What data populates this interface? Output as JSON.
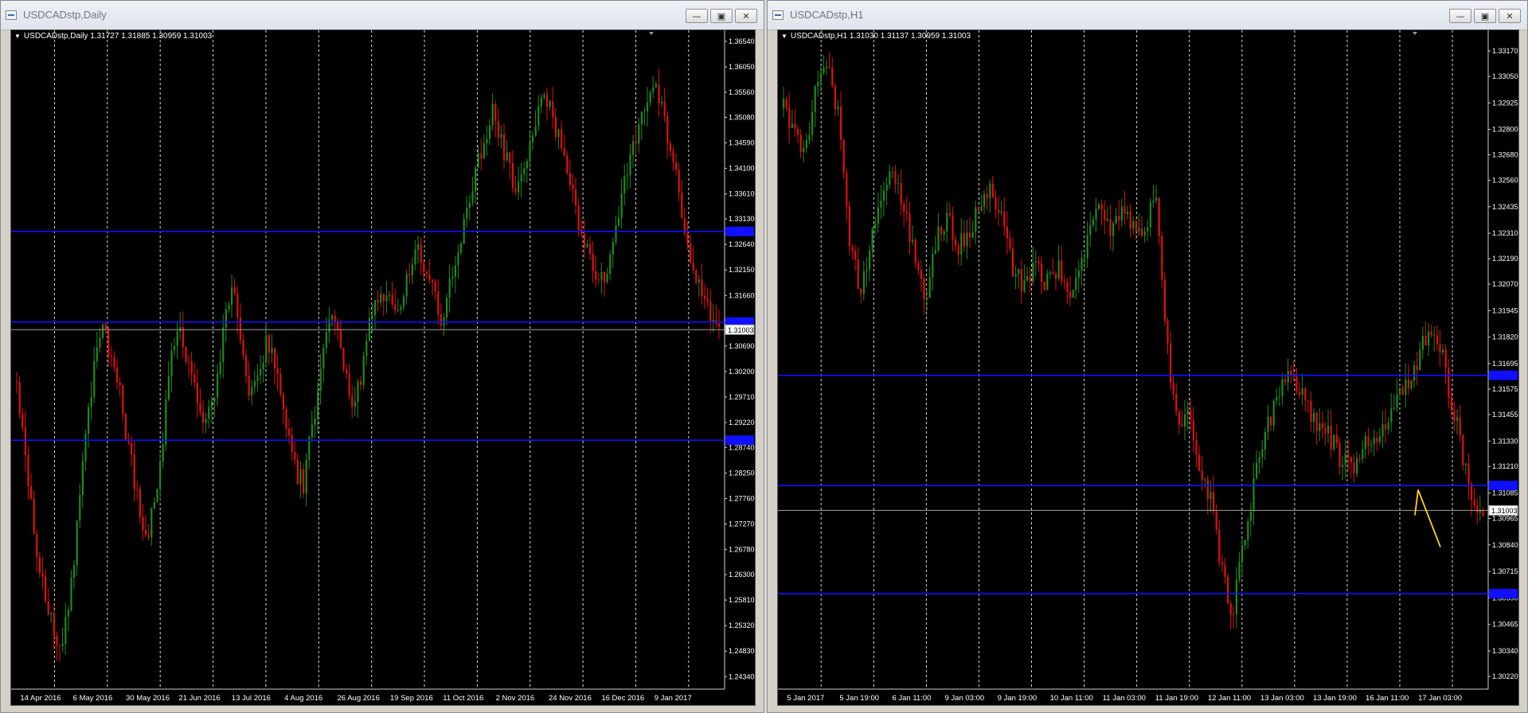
{
  "colors": {
    "background": "#000000",
    "grid": "#ffffff",
    "bull": "#1f8a1f",
    "bear": "#e01010",
    "level": "#1010ff",
    "price_line": "#a0a0a0",
    "arrow": "#ffd21a"
  },
  "windows": [
    {
      "title": "USDCADstp,Daily",
      "info": "USDCADstp,Daily  1.31727 1.31885 1.30959 1.31003",
      "controls": [
        "minimize-icon",
        "restore-icon",
        "close-icon"
      ],
      "chart_data": {
        "type": "candlestick",
        "symbol": "USDCADstp",
        "timeframe": "Daily",
        "ohlc_last": {
          "open": 1.31727,
          "high": 1.31885,
          "low": 1.30959,
          "close": 1.31003
        },
        "current_price": "1.31003",
        "ylim": [
          1.241,
          1.366
        ],
        "y_ticks": [
          "1.36540",
          "1.36050",
          "1.35560",
          "1.35080",
          "1.34590",
          "1.34100",
          "1.33610",
          "1.33130",
          "1.32640",
          "1.32150",
          "1.31660",
          "1.31180",
          "1.30690",
          "1.30200",
          "1.29710",
          "1.29220",
          "1.28740",
          "1.28250",
          "1.27760",
          "1.27270",
          "1.26780",
          "1.26300",
          "1.25810",
          "1.25320",
          "1.24830",
          "1.24340"
        ],
        "x_labels": [
          "14 Apr 2016",
          "6 May 2016",
          "30 May 2016",
          "21 Jun 2016",
          "13 Jul 2016",
          "4 Aug 2016",
          "26 Aug 2016",
          "19 Sep 2016",
          "11 Oct 2016",
          "2 Nov 2016",
          "24 Nov 2016",
          "16 Dec 2016",
          "9 Jan 2017"
        ],
        "levels": [
          1.3289,
          1.3115,
          1.2888
        ],
        "grid": true,
        "close_path": [
          1.3,
          1.287,
          1.27,
          1.262,
          1.254,
          1.248,
          1.258,
          1.272,
          1.29,
          1.303,
          1.311,
          1.303,
          1.297,
          1.286,
          1.277,
          1.27,
          1.278,
          1.292,
          1.306,
          1.31,
          1.302,
          1.296,
          1.292,
          1.3,
          1.312,
          1.318,
          1.307,
          1.297,
          1.303,
          1.308,
          1.3,
          1.292,
          1.284,
          1.28,
          1.29,
          1.302,
          1.312,
          1.309,
          1.3,
          1.296,
          1.304,
          1.314,
          1.318,
          1.316,
          1.312,
          1.32,
          1.326,
          1.323,
          1.317,
          1.312,
          1.32,
          1.326,
          1.332,
          1.34,
          1.348,
          1.352,
          1.345,
          1.34,
          1.336,
          1.346,
          1.352,
          1.355,
          1.35,
          1.344,
          1.336,
          1.33,
          1.325,
          1.319,
          1.322,
          1.33,
          1.338,
          1.344,
          1.352,
          1.357,
          1.355,
          1.348,
          1.34,
          1.33,
          1.322,
          1.316,
          1.312,
          1.31
        ]
      }
    },
    {
      "title": "USDCADstp,H1",
      "info": "USDCADstp,H1  1.31030 1.31137 1.30959 1.31003",
      "controls": [
        "minimize-icon",
        "restore-icon",
        "close-icon"
      ],
      "chart_data": {
        "type": "candlestick",
        "symbol": "USDCADstp",
        "timeframe": "H1",
        "ohlc_last": {
          "open": 1.3103,
          "high": 1.31137,
          "low": 1.30959,
          "close": 1.31003
        },
        "current_price": "1.31003",
        "ylim": [
          1.3016,
          1.3323
        ],
        "y_ticks": [
          "1.33170",
          "1.33050",
          "1.32925",
          "1.32800",
          "1.32680",
          "1.32560",
          "1.32435",
          "1.32310",
          "1.32190",
          "1.32070",
          "1.31945",
          "1.31820",
          "1.31695",
          "1.31575",
          "1.31455",
          "1.31330",
          "1.31210",
          "1.31085",
          "1.30965",
          "1.30840",
          "1.30715",
          "1.30590",
          "1.30465",
          "1.30340",
          "1.30220"
        ],
        "x_labels": [
          "5 Jan 2017",
          "5 Jan 19:00",
          "6 Jan 11:00",
          "9 Jan 03:00",
          "9 Jan 19:00",
          "10 Jan 11:00",
          "11 Jan 03:00",
          "11 Jan 19:00",
          "12 Jan 11:00",
          "13 Jan 03:00",
          "13 Jan 19:00",
          "16 Jan 11:00",
          "17 Jan 03:00"
        ],
        "levels": [
          1.3164,
          1.3112,
          1.3061
        ],
        "grid": true,
        "close_path": [
          1.329,
          1.328,
          1.327,
          1.33,
          1.331,
          1.3285,
          1.323,
          1.3205,
          1.3228,
          1.325,
          1.3262,
          1.3245,
          1.322,
          1.32,
          1.323,
          1.3238,
          1.3225,
          1.323,
          1.3248,
          1.325,
          1.3235,
          1.3215,
          1.3205,
          1.3215,
          1.3208,
          1.3215,
          1.3205,
          1.3208,
          1.3232,
          1.3243,
          1.323,
          1.324,
          1.3236,
          1.3228,
          1.325,
          1.318,
          1.314,
          1.315,
          1.312,
          1.3108,
          1.3075,
          1.305,
          1.308,
          1.3112,
          1.3135,
          1.315,
          1.3162,
          1.3158,
          1.3148,
          1.314,
          1.3135,
          1.3125,
          1.312,
          1.313,
          1.3135,
          1.3142,
          1.315,
          1.3158,
          1.317,
          1.3185,
          1.318,
          1.3155,
          1.313,
          1.3108,
          1.31
        ],
        "annotation": {
          "type": "arrow",
          "color": "yellow",
          "from": {
            "x": "17 Jan 03:00",
            "y": 1.3102
          },
          "to": {
            "x": "after 17 Jan 03:00",
            "y": 1.3083
          }
        }
      }
    }
  ]
}
